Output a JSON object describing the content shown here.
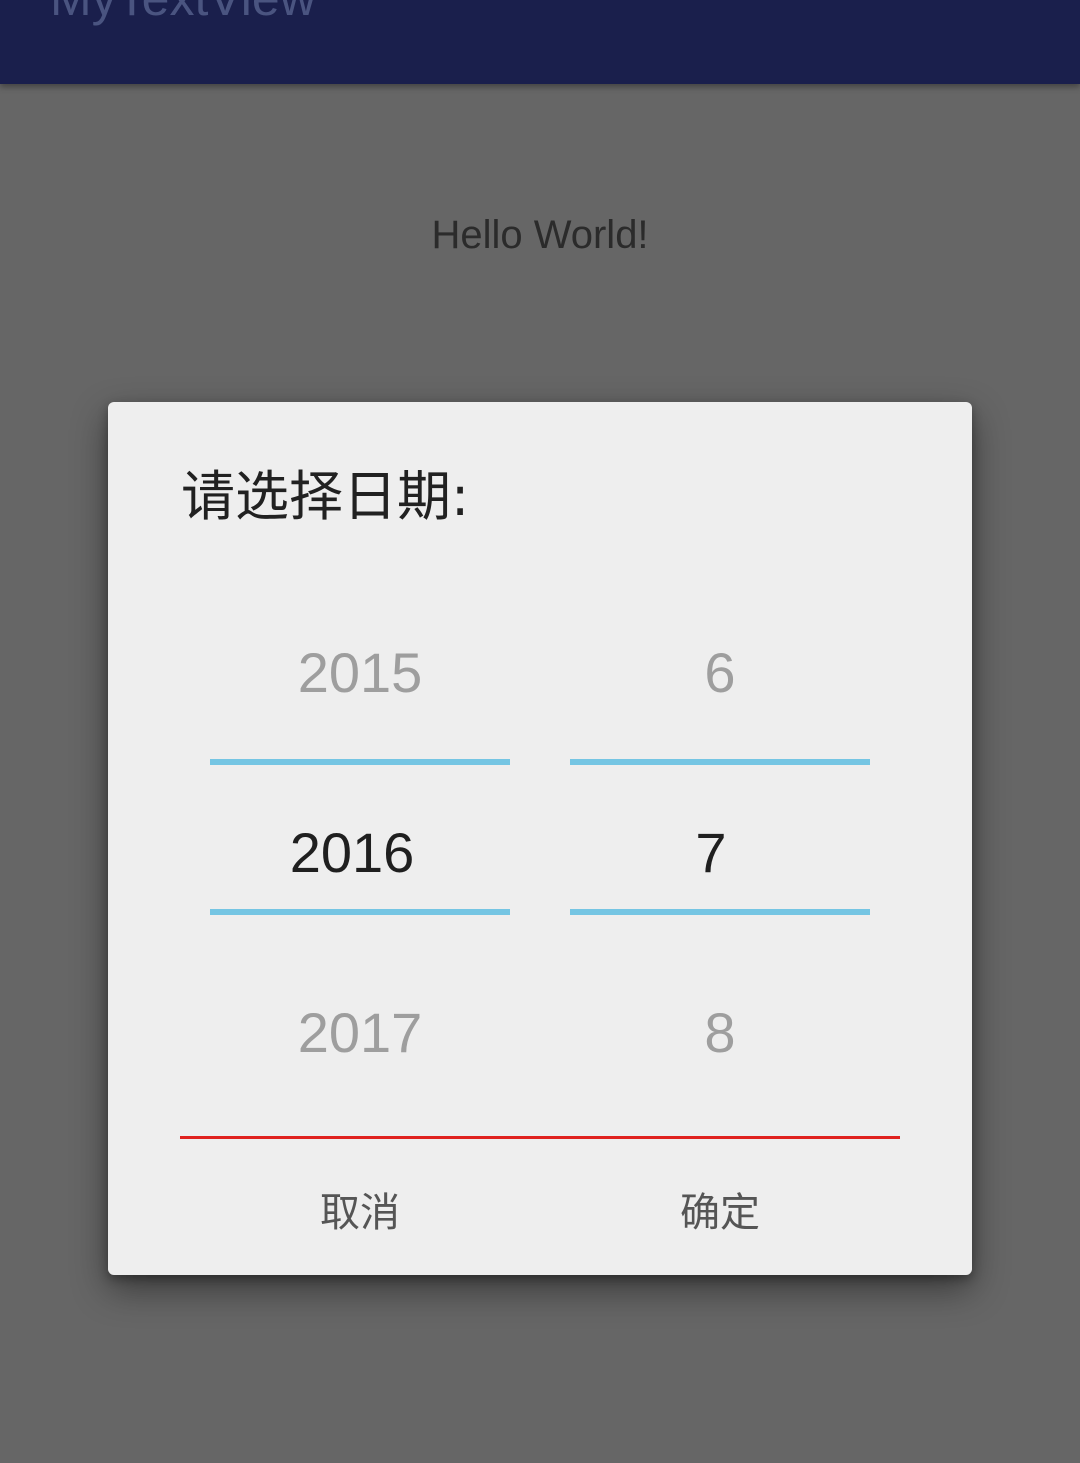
{
  "app": {
    "title": "MyTextView",
    "appbar_color": "#1a1f4c"
  },
  "main": {
    "hello_text": "Hello World!"
  },
  "dialog": {
    "title": "请选择日期:",
    "year_picker": {
      "prev": "2015",
      "selected": "2016",
      "next": "2017"
    },
    "month_picker": {
      "prev": "6",
      "selected": "7",
      "next": "8"
    },
    "divider_color": "#75c5e3",
    "separator_color": "#e0221f",
    "cancel_label": "取消",
    "confirm_label": "确定"
  }
}
